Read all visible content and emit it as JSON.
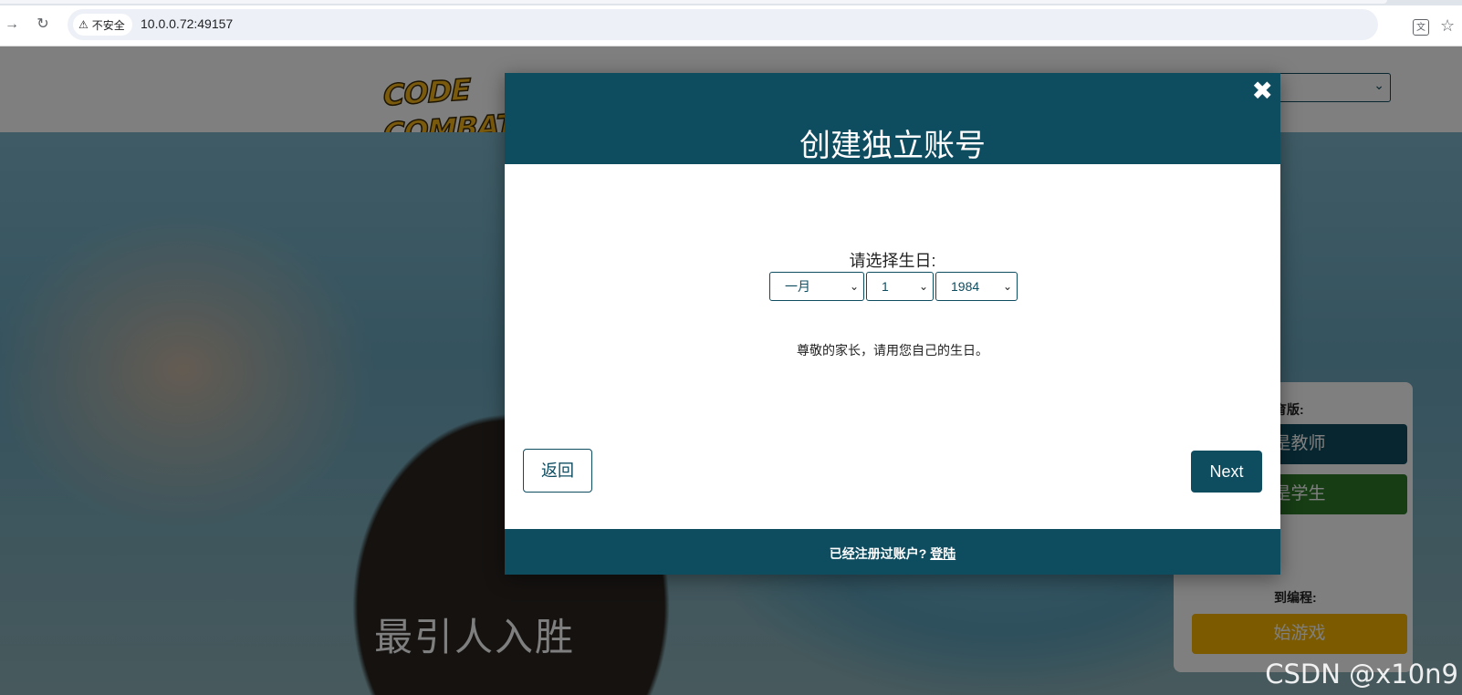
{
  "browser": {
    "security_label": "不安全",
    "url": "10.0.0.72:49157"
  },
  "page": {
    "logo_text": "CODE COMBAT",
    "hero_text": "最引人入胜",
    "side_card": {
      "section1_label": "育版:",
      "teacher_button": "是教师",
      "student_button": "是学生",
      "section2_label": "到编程:",
      "play_button": "始游戏"
    },
    "watermark": "CSDN @x10n9"
  },
  "modal": {
    "title": "创建独立账号",
    "birthday_label": "请选择生日:",
    "month_value": "一月",
    "day_value": "1",
    "year_value": "1984",
    "note": "尊敬的家长，请用您自己的生日。",
    "back_label": "返回",
    "next_label": "Next",
    "footer_prompt": "已经注册过账户?",
    "footer_link": "登陆"
  }
}
